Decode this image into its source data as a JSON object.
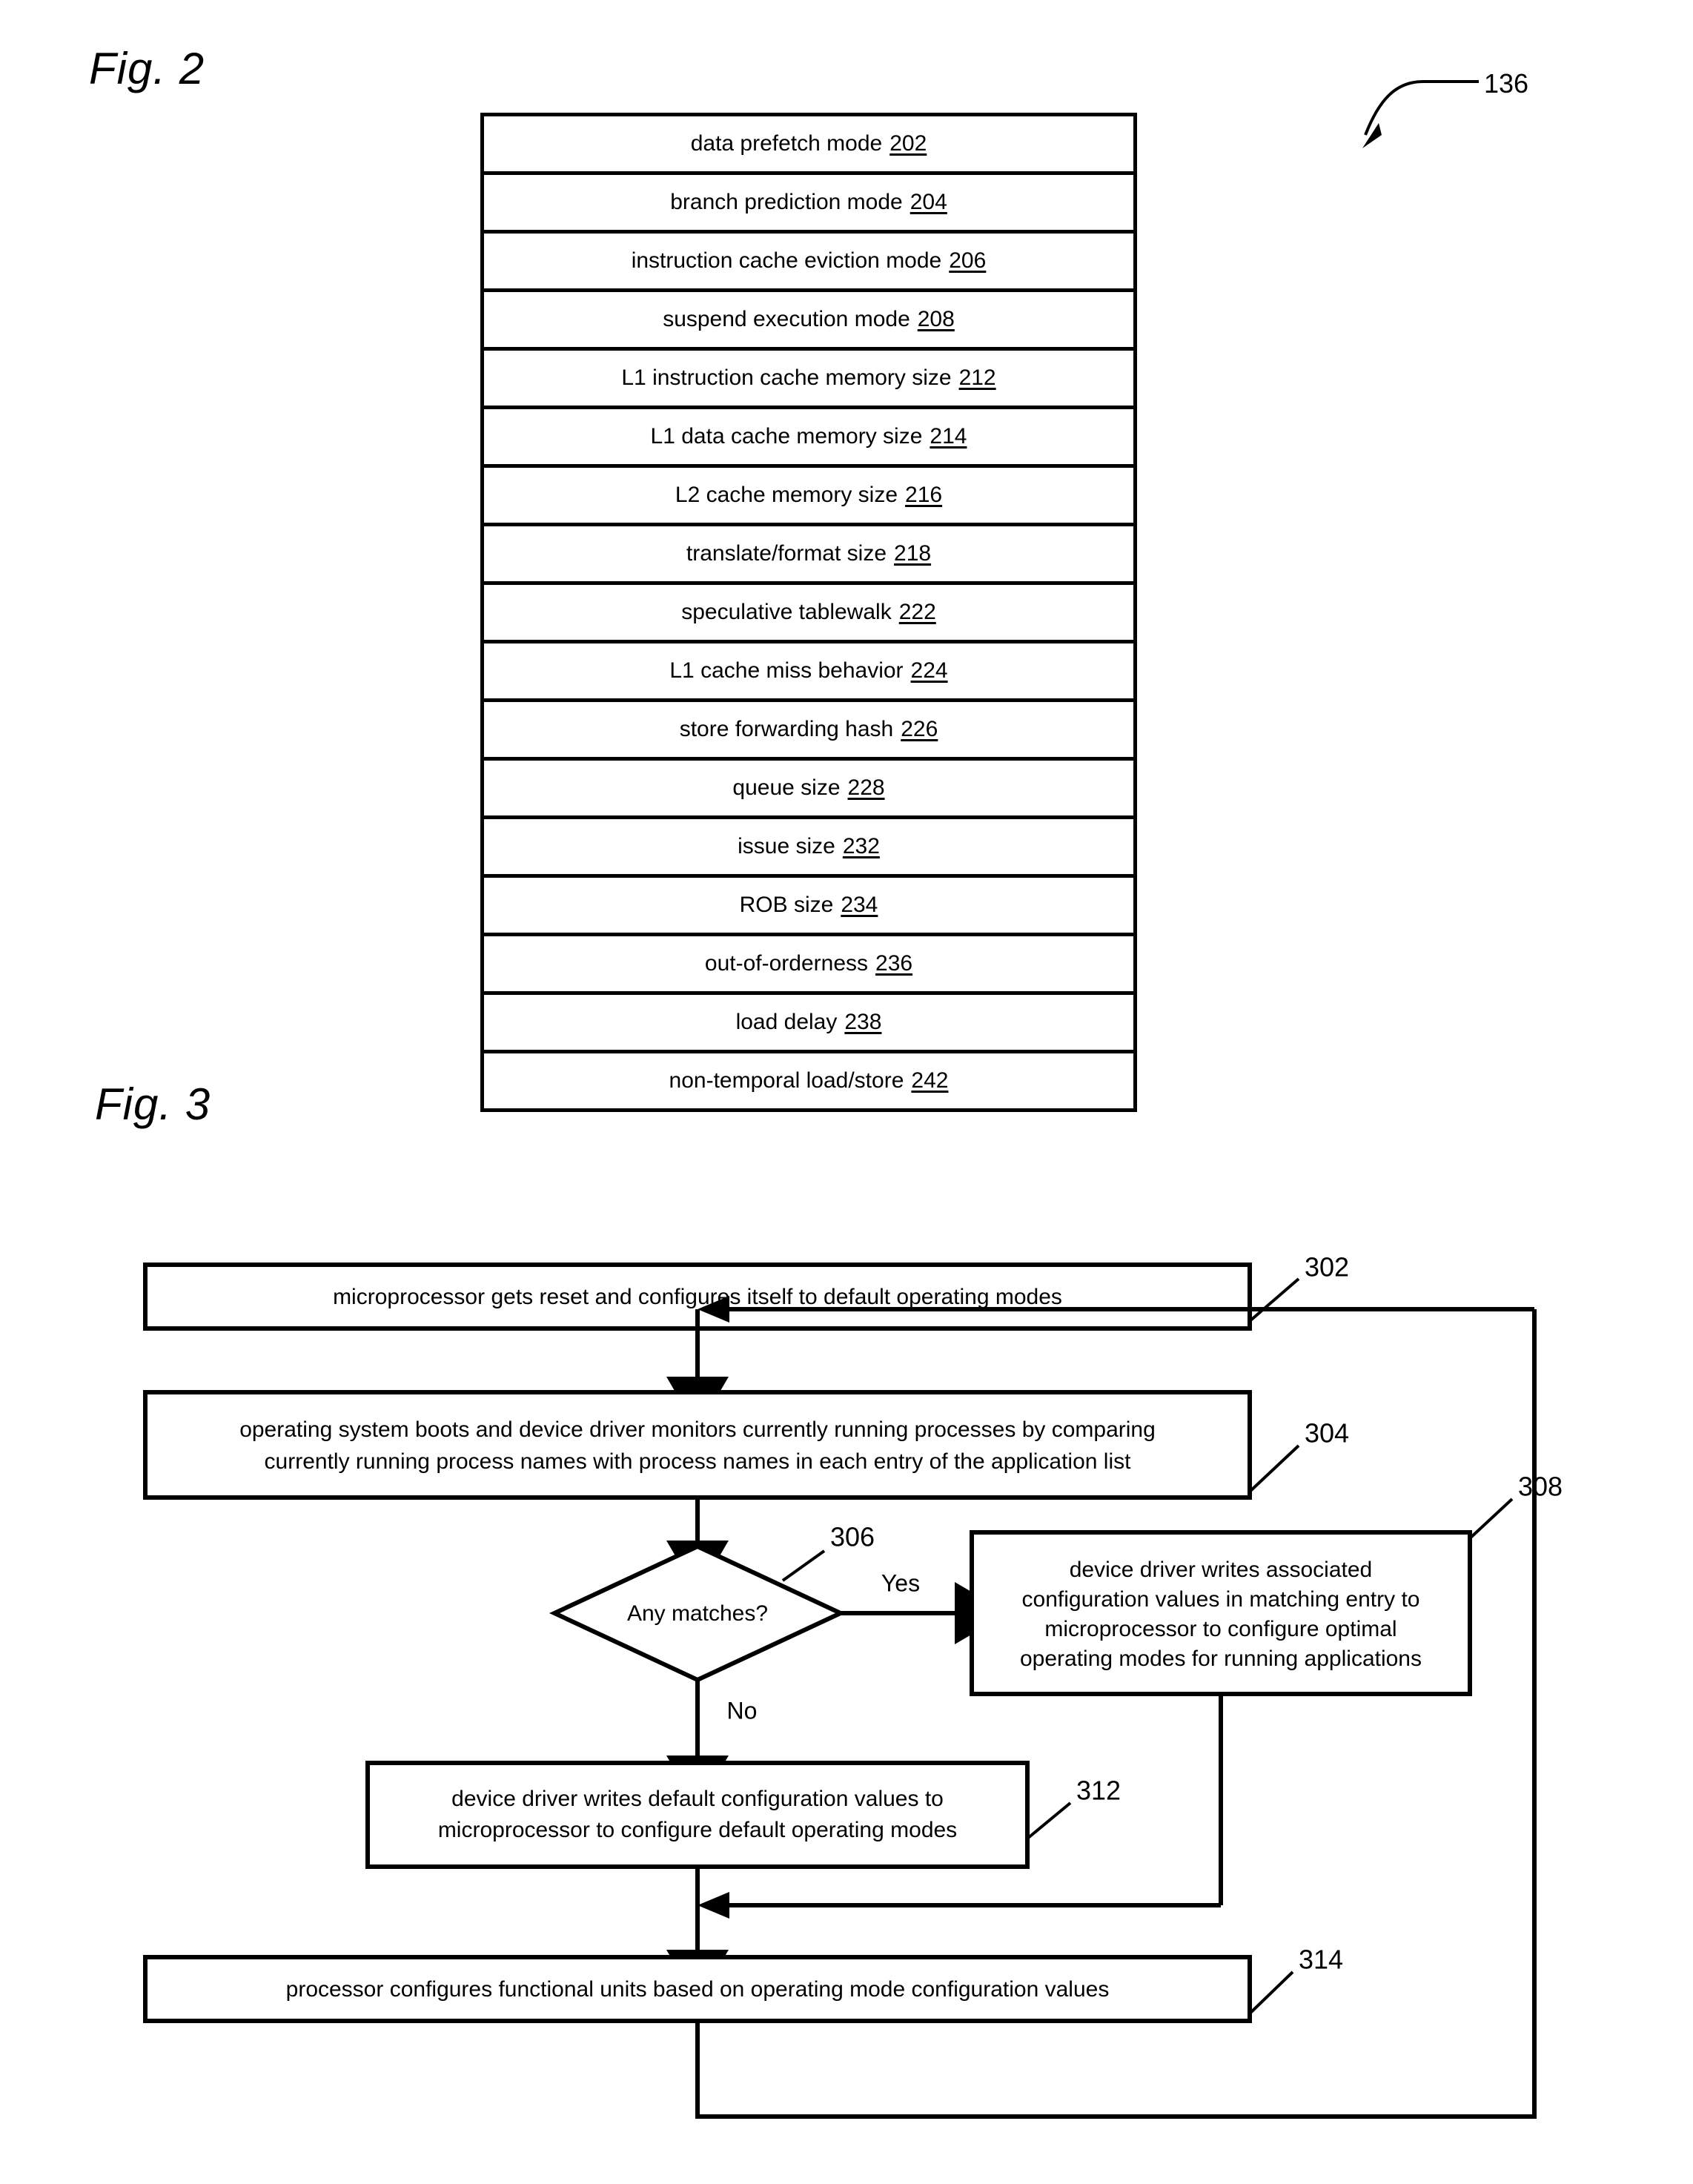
{
  "figures": {
    "fig2": {
      "label": "Fig. 2",
      "callout_ref": "136",
      "rows": [
        {
          "text": "data prefetch mode",
          "ref": "202"
        },
        {
          "text": "branch prediction mode",
          "ref": "204"
        },
        {
          "text": "instruction cache eviction mode",
          "ref": "206"
        },
        {
          "text": "suspend execution mode",
          "ref": "208"
        },
        {
          "text": "L1 instruction cache memory size",
          "ref": "212"
        },
        {
          "text": "L1 data cache memory size",
          "ref": "214"
        },
        {
          "text": "L2 cache memory size",
          "ref": "216"
        },
        {
          "text": "translate/format size",
          "ref": "218"
        },
        {
          "text": "speculative tablewalk",
          "ref": "222"
        },
        {
          "text": "L1 cache miss behavior",
          "ref": "224"
        },
        {
          "text": "store forwarding hash",
          "ref": "226"
        },
        {
          "text": "queue size",
          "ref": "228"
        },
        {
          "text": "issue size",
          "ref": "232"
        },
        {
          "text": "ROB size",
          "ref": "234"
        },
        {
          "text": "out-of-orderness",
          "ref": "236"
        },
        {
          "text": "load delay",
          "ref": "238"
        },
        {
          "text": "non-temporal load/store",
          "ref": "242"
        }
      ]
    },
    "fig3": {
      "label": "Fig. 3",
      "nodes": {
        "step302": {
          "ref": "302",
          "lines": [
            "microprocessor gets reset and configures itself to default operating modes"
          ]
        },
        "step304": {
          "ref": "304",
          "lines": [
            "operating system boots and device driver monitors currently running processes by comparing",
            "currently running process names with process names in each entry of the application list"
          ]
        },
        "decision306": {
          "ref": "306",
          "lines": [
            "Any matches?"
          ]
        },
        "step308": {
          "ref": "308",
          "lines": [
            "device driver writes associated",
            "configuration values in matching entry to",
            "microprocessor to configure optimal",
            "operating modes for running applications"
          ]
        },
        "step312": {
          "ref": "312",
          "lines": [
            "device driver writes default configuration values to",
            "microprocessor to configure default operating modes"
          ]
        },
        "step314": {
          "ref": "314",
          "lines": [
            "processor configures functional units based on operating mode configuration values"
          ]
        }
      },
      "branch_labels": {
        "yes": "Yes",
        "no": "No"
      }
    }
  },
  "colors": {
    "stroke": "#000000",
    "background": "#ffffff"
  }
}
